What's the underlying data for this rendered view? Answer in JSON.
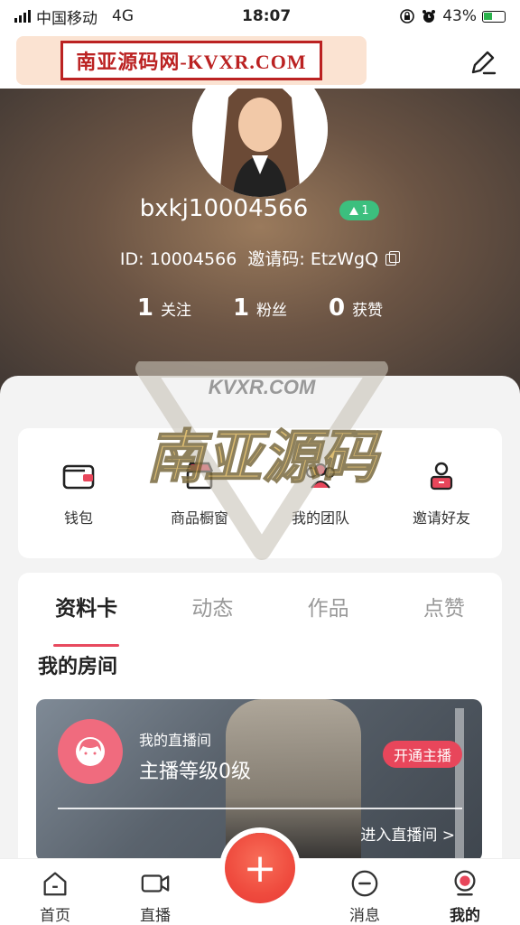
{
  "status_bar": {
    "carrier": "中国移动",
    "network": "4G",
    "time": "18:07",
    "battery": "43%"
  },
  "watermark": {
    "banner_text": "南亚源码网-KVXR.COM",
    "overlay_text": "南亚源码",
    "overlay_sub": "KVXR.COM"
  },
  "profile": {
    "username": "bxkj10004566",
    "level": "1",
    "id_line": "ID: 10004566  邀请码: EtzWgQ",
    "stats": [
      {
        "num": "1",
        "label": "关注"
      },
      {
        "num": "1",
        "label": "粉丝"
      },
      {
        "num": "0",
        "label": "获赞"
      }
    ]
  },
  "quick_actions": [
    {
      "label": "钱包",
      "icon": "wallet-icon"
    },
    {
      "label": "商品橱窗",
      "icon": "shop-icon"
    },
    {
      "label": "我的团队",
      "icon": "team-icon"
    },
    {
      "label": "邀请好友",
      "icon": "invite-icon"
    }
  ],
  "tabs": [
    {
      "label": "资料卡",
      "active": true
    },
    {
      "label": "动态",
      "active": false
    },
    {
      "label": "作品",
      "active": false
    },
    {
      "label": "点赞",
      "active": false
    }
  ],
  "my_room": {
    "section_title": "我的房间",
    "subtitle": "我的直播间",
    "level_text": "主播等级0级",
    "open_button": "开通主播",
    "enter_link": "进入直播间 >"
  },
  "tabbar": [
    {
      "label": "首页",
      "icon": "home-icon"
    },
    {
      "label": "直播",
      "icon": "video-icon"
    },
    {
      "label": "消息",
      "icon": "message-icon"
    },
    {
      "label": "我的",
      "icon": "profile-icon",
      "active": true
    }
  ],
  "colors": {
    "accent": "#e8465b",
    "level_badge": "#3cbf7e",
    "fab": "#ef4b3e"
  }
}
